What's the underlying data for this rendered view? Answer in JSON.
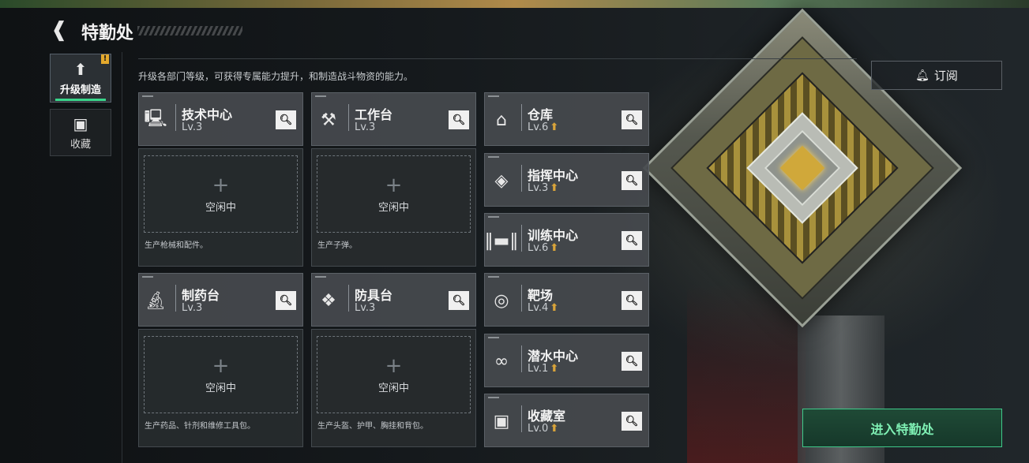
{
  "header": {
    "back_icon": "chevron-left-icon",
    "title": "特勤处"
  },
  "side_tabs": [
    {
      "label": "升级制造",
      "icon": "upgrade-icon",
      "badge": "!",
      "active": true
    },
    {
      "label": "收藏",
      "icon": "collection-icon",
      "active": false
    }
  ],
  "description": "升级各部门等级，可获得专属能力提升，和制造战斗物资的能力。",
  "subscribe": {
    "label": "订阅",
    "icon": "bell-icon"
  },
  "production": [
    {
      "name": "技术中心",
      "level": "Lv.3",
      "icon": "computer-icon",
      "slot_status": "空闲中",
      "slot_desc": "生产枪械和配件。"
    },
    {
      "name": "工作台",
      "level": "Lv.3",
      "icon": "tools-icon",
      "slot_status": "空闲中",
      "slot_desc": "生产子弹。"
    },
    {
      "name": "制药台",
      "level": "Lv.3",
      "icon": "microscope-icon",
      "slot_status": "空闲中",
      "slot_desc": "生产药品、针剂和维修工具包。"
    },
    {
      "name": "防具台",
      "level": "Lv.3",
      "icon": "armor-icon",
      "slot_status": "空闲中",
      "slot_desc": "生产头盔、护甲、胸挂和背包。"
    }
  ],
  "facilities": [
    {
      "name": "仓库",
      "level": "Lv.6",
      "icon": "warehouse-icon"
    },
    {
      "name": "指挥中心",
      "level": "Lv.3",
      "icon": "command-icon"
    },
    {
      "name": "训练中心",
      "level": "Lv.6",
      "icon": "dumbbell-icon"
    },
    {
      "name": "靶场",
      "level": "Lv.4",
      "icon": "target-icon"
    },
    {
      "name": "潜水中心",
      "level": "Lv.1",
      "icon": "diving-mask-icon"
    },
    {
      "name": "收藏室",
      "level": "Lv.0",
      "icon": "trophy-icon"
    }
  ],
  "enter_button": "进入特勤处",
  "colors": {
    "accent_green": "#3fc98a",
    "upgrade_gold": "#d9a43a"
  }
}
